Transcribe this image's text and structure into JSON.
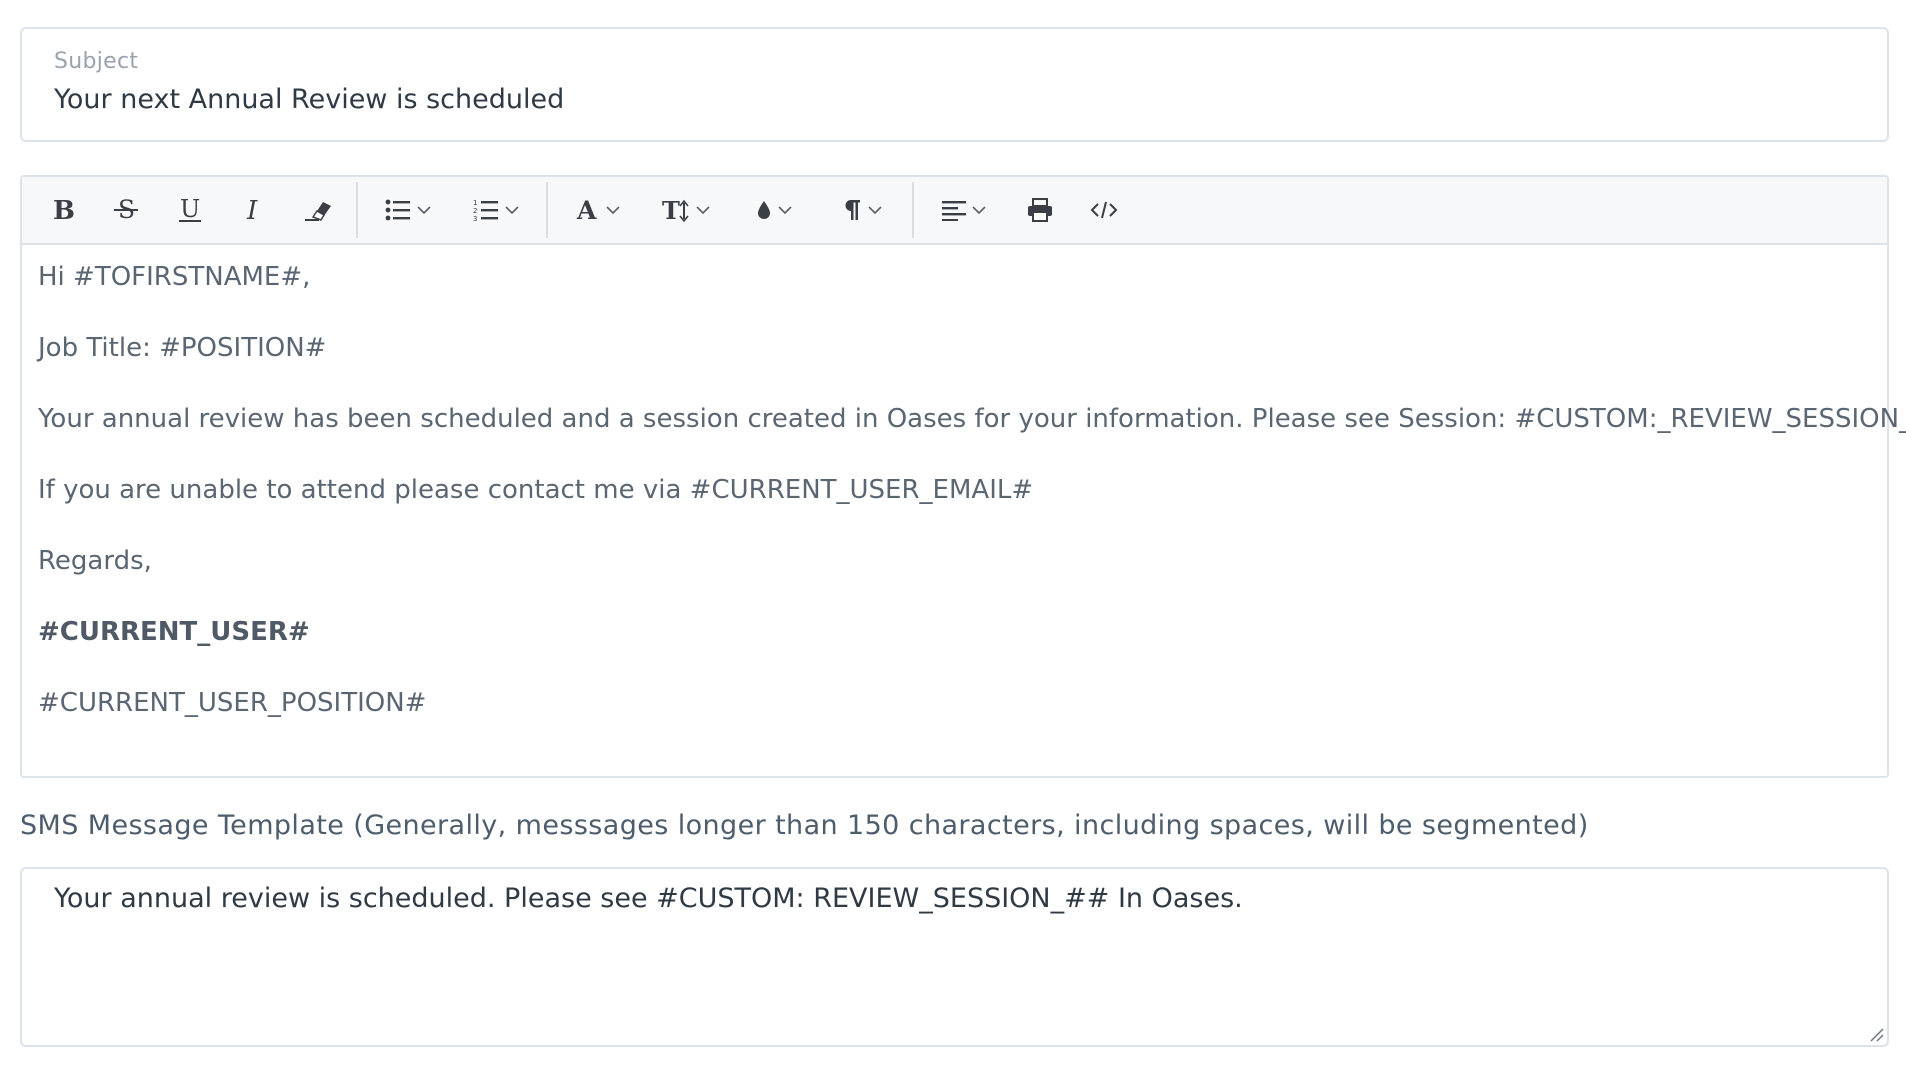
{
  "subject": {
    "label": "Subject",
    "value": "Your next Annual Review is scheduled"
  },
  "toolbar": {
    "buttons": [
      {
        "icon": "bold-icon"
      },
      {
        "icon": "strikethrough-icon"
      },
      {
        "icon": "underline-icon"
      },
      {
        "icon": "italic-icon"
      },
      {
        "icon": "eraser-icon"
      },
      {
        "icon": "bulleted-list-icon",
        "dropdown": true
      },
      {
        "icon": "numbered-list-icon",
        "dropdown": true
      },
      {
        "icon": "font-family-icon",
        "dropdown": true
      },
      {
        "icon": "font-size-icon",
        "dropdown": true
      },
      {
        "icon": "text-color-icon",
        "dropdown": true
      },
      {
        "icon": "paragraph-icon",
        "dropdown": true
      },
      {
        "icon": "align-icon",
        "dropdown": true
      },
      {
        "icon": "print-icon"
      },
      {
        "icon": "code-view-icon"
      }
    ]
  },
  "editor": {
    "greeting": "Hi #TOFIRSTNAME#,",
    "job_title": "Job Title: #POSITION#",
    "body": "Your annual review has been scheduled and a session created in Oases for your information. Please see Session: #CUSTOM:_REVIEW_SESSION_##",
    "contact": "If you are unable to attend please contact me via #CURRENT_USER_EMAIL#",
    "regards": "Regards,",
    "sender": "#CURRENT_USER#",
    "sender_position": "#CURRENT_USER_POSITION#"
  },
  "sms": {
    "label": "SMS Message Template (Generally, messsages longer than 150 characters, including spaces, will be segmented)",
    "value": "Your annual review is scheduled. Please see #CUSTOM: REVIEW_SESSION_## In Oases."
  }
}
